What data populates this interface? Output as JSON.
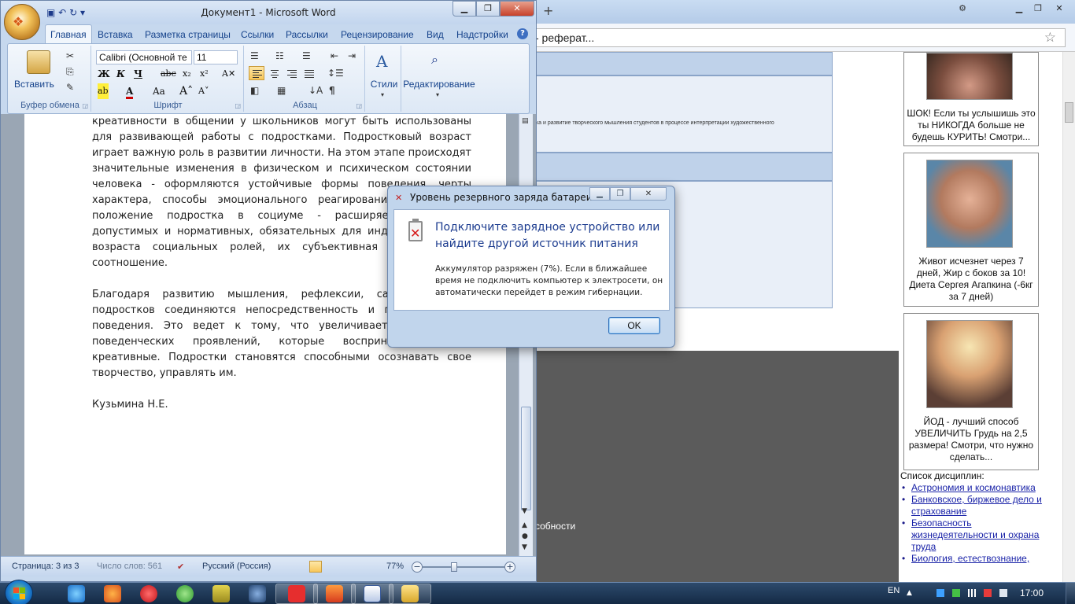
{
  "browser": {
    "address_text": "- реферат...",
    "document_snippet": "ика и развитие творческого мышления студентов в процессе интерпретации художественного",
    "bottom_text": "собности",
    "ads": [
      {
        "caption": "ШОК! Если ты услышишь это ты НИКОГДА больше не будешь КУРИТЬ! Смотри..."
      },
      {
        "caption": "Живот исчезнет через 7 дней, Жир с боков за 10! Диета Сергея Агапкина (-6кг за 7 дней)"
      },
      {
        "caption": "ЙОД - лучший способ УВЕЛИЧИТЬ Грудь на 2,5 размера! Смотри, что нужно сделать..."
      }
    ],
    "disciplines": {
      "title": "Список дисциплин:",
      "items": [
        "Астрономия и космонавтика",
        "Банковское, биржевое дело и страхование",
        "Безопасность жизнедеятельности и охрана труда",
        "Биология, естествознание,"
      ]
    }
  },
  "word": {
    "title": "Документ1 - Microsoft Word",
    "tabs": [
      "Главная",
      "Вставка",
      "Разметка страницы",
      "Ссылки",
      "Рассылки",
      "Рецензирование",
      "Вид",
      "Надстройки"
    ],
    "ribbon": {
      "paste_label": "Вставить",
      "clipboard_group": "Буфер обмена",
      "font_name": "Calibri (Основной те",
      "font_size": "11",
      "font_group": "Шрифт",
      "paragraph_group": "Абзац",
      "styles_label": "Стили",
      "editing_label": "Редактирование"
    },
    "paragraphs": [
      "креативности в общении у школьников могут быть использованы для развивающей работы с подростками. Подростковый возраст играет важную роль в развитии личности. На этом этапе происходят значительные изменения в физическом и психическом состоянии человека - оформляются устойчивые формы поведения, черты характера, способы эмоционального реагирования. Изменяется положение подростка в социуме - расширяется диапазон допустимых и нормативных, обязательных для индивида данного возраста социальных ролей, их субъективная значимость и соотношение.",
      "Благодаря развитию мышления, рефлексии, самосознания у подростков соединяются непосредственность и произвольность поведения. Это ведет к тому, что увеличивается количество поведенческих проявлений, которые воспринимаются как креативные. Подростки становятся способными осознавать свое творчество, управлять им.",
      "Кузьмина Н.Е."
    ],
    "status": {
      "page": "Страница: 3 из 3",
      "words": "Число слов: 561",
      "language": "Русский (Россия)",
      "zoom": "77%"
    }
  },
  "dialog": {
    "title": "Уровень резервного заряда батареи",
    "heading": "Подключите зарядное устройство или найдите другой источник питания",
    "message": "Аккумулятор разряжен (7%). Если в ближайшее время не подключить компьютер к электросети, он автоматически перейдет в режим гибернации.",
    "ok_label": "OK"
  },
  "taskbar": {
    "language": "EN",
    "clock": "17:00"
  },
  "colors": {
    "ribbon_accent": "#15428b",
    "dialog_heading": "#1c3c8f",
    "taskbar": "#1e3857"
  }
}
